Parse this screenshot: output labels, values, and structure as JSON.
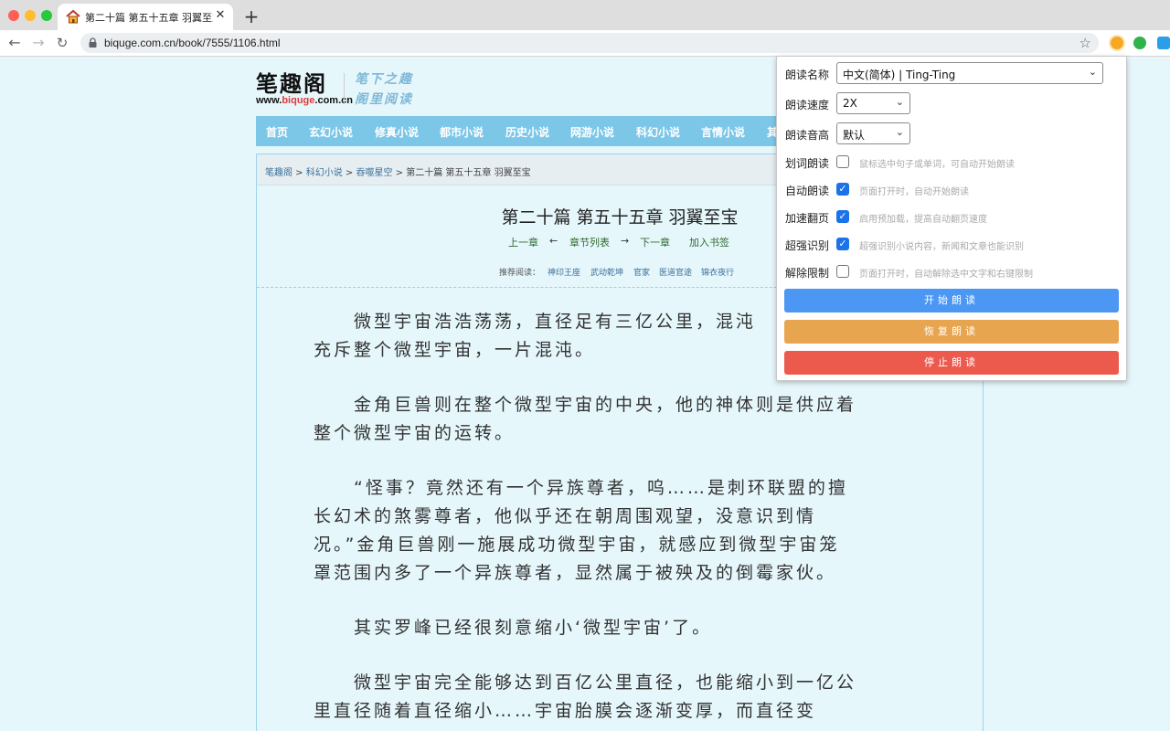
{
  "browser": {
    "tab_title": "第二十篇 第五十五章 羽翼至宝_吞噬星空",
    "url": "biquge.com.cn/book/7555/1106.html"
  },
  "site": {
    "logo": "笔趣阁",
    "logo_url_prefix": "www.",
    "logo_url_highlight": "biquge",
    "logo_url_suffix": ".com.cn",
    "slogan_line1": "笔下之趣",
    "slogan_line2": "阁里阅读"
  },
  "nav": [
    "首页",
    "玄幻小说",
    "修真小说",
    "都市小说",
    "历史小说",
    "网游小说",
    "科幻小说",
    "言情小说",
    "其"
  ],
  "breadcrumb": {
    "home": "笔趣阁",
    "sep1": " > ",
    "category": "科幻小说",
    "sep2": " > ",
    "book": "吞噬星空",
    "sep3": " > ",
    "chapter": "第二十篇 第五十五章 羽翼至宝"
  },
  "chapter": {
    "title": "第二十篇 第五十五章 羽翼至宝",
    "prev": "上一章",
    "arrow_left": "←",
    "list": "章节列表",
    "arrow_right": "→",
    "next": "下一章",
    "bookmark": "加入书签"
  },
  "recommend": {
    "label": "推荐阅读：",
    "items": [
      "神印王座",
      "武动乾坤",
      "官家",
      "医道官途",
      "锦衣夜行"
    ]
  },
  "paragraphs": [
    "　　微型宇宙浩浩荡荡，直径足有三亿公里，混沌\n充斥整个微型宇宙，一片混沌。",
    "　　金角巨兽则在整个微型宇宙的中央，他的神体则是供应着\n整个微型宇宙的运转。",
    "　　“怪事？竟然还有一个异族尊者，呜……是刺环联盟的擅\n长幻术的煞雾尊者，他似乎还在朝周围观望，没意识到情\n况。”金角巨兽刚一施展成功微型宇宙，就感应到微型宇宙笼\n罩范围内多了一个异族尊者，显然属于被殃及的倒霉家伙。",
    "　　其实罗峰已经很刻意缩小‘微型宇宙’了。",
    "　　微型宇宙完全能够达到百亿公里直径，也能缩小到一亿公\n里直径随着直径缩小……宇宙胎膜会逐渐变厚，而直径变"
  ],
  "popup": {
    "voice_label": "朗读名称",
    "voice_value": "中文(简体) | Ting-Ting",
    "speed_label": "朗读速度",
    "speed_value": "2X",
    "pitch_label": "朗读音高",
    "pitch_value": "默认",
    "options": [
      {
        "label": "划词朗读",
        "checked": false,
        "hint": "鼠标选中句子或单词，可自动开始朗读"
      },
      {
        "label": "自动朗读",
        "checked": true,
        "hint": "页面打开时，自动开始朗读"
      },
      {
        "label": "加速翻页",
        "checked": true,
        "hint": "启用预加载，提高自动翻页速度"
      },
      {
        "label": "超强识别",
        "checked": true,
        "hint": "超强识别小说内容，新闻和文章也能识别"
      },
      {
        "label": "解除限制",
        "checked": false,
        "hint": "页面打开时，自动解除选中文字和右键限制"
      }
    ],
    "start_button": "开始朗读",
    "resume_button": "恢复朗读",
    "stop_button": "停止朗读",
    "check_mark": "✓"
  },
  "colors": {
    "page_bg": "#e6f7fc",
    "nav_bg": "#7cc7e8",
    "start": "#4b97f3",
    "resume": "#e8a54f",
    "stop": "#ec5a4e",
    "checkbox_on": "#1a73e8"
  }
}
